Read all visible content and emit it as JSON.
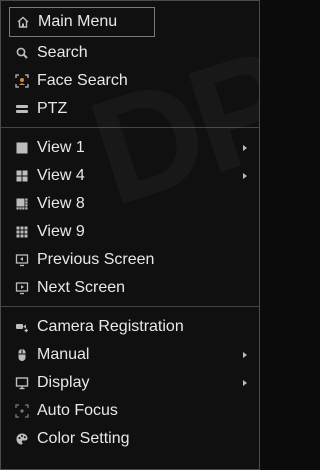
{
  "menu": {
    "items": [
      {
        "label": "Main Menu",
        "icon": "home-icon"
      },
      {
        "label": "Search",
        "icon": "search-icon"
      },
      {
        "label": "Face Search",
        "icon": "face-search-icon"
      },
      {
        "label": "PTZ",
        "icon": "ptz-icon"
      },
      {
        "label": "View 1",
        "icon": "view1-icon"
      },
      {
        "label": "View 4",
        "icon": "view4-icon"
      },
      {
        "label": "View 8",
        "icon": "view8-icon"
      },
      {
        "label": "View 9",
        "icon": "view9-icon"
      },
      {
        "label": "Previous Screen",
        "icon": "previous-screen-icon"
      },
      {
        "label": "Next Screen",
        "icon": "next-screen-icon"
      },
      {
        "label": "Camera Registration",
        "icon": "camera-registration-icon"
      },
      {
        "label": "Manual",
        "icon": "manual-icon"
      },
      {
        "label": "Display",
        "icon": "display-icon"
      },
      {
        "label": "Auto Focus",
        "icon": "auto-focus-icon"
      },
      {
        "label": "Color Setting",
        "icon": "color-setting-icon"
      }
    ]
  },
  "colors": {
    "background": "#101010",
    "text": "#e8e8e8",
    "icon": "#bdbdbd",
    "divider": "#454545"
  }
}
